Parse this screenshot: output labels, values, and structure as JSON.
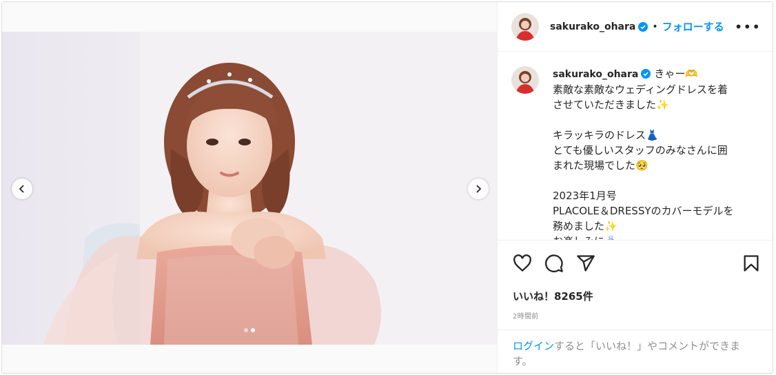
{
  "post": {
    "username": "sakurako_ohara",
    "verified": true,
    "follow_separator": "•",
    "follow_label": "フォローする",
    "more_label": "•••",
    "caption": {
      "username": "sakurako_ohara",
      "lines": [
        "きゃー🫶",
        "素敵な素敵なウェディングドレスを着",
        "させていただきました✨",
        "",
        "キラッキラのドレス👗",
        "とても優しいスタッフのみなさんに囲",
        "まれた現場でした🥺",
        "",
        "2023年1月号",
        "PLACOLE＆DRESSYのカバーモデルを",
        "務めました✨",
        "お楽しみに💍"
      ]
    },
    "likes_label": "いいね！8265件",
    "timestamp": "2時間前",
    "login_prompt": {
      "link": "ログイン",
      "rest": "すると「いいね！」やコメントができます。"
    },
    "carousel": {
      "slide_count": 2,
      "active_index": 1
    }
  },
  "icons": {
    "like": "heart-icon",
    "comment": "comment-icon",
    "share": "paper-plane-icon",
    "save": "bookmark-icon",
    "prev": "chevron-left-icon",
    "next": "chevron-right-icon",
    "verified": "verified-badge-icon"
  },
  "colors": {
    "accent": "#0095f6",
    "text": "#262626",
    "muted": "#8e8e8e",
    "border": "#dbdbdb"
  }
}
